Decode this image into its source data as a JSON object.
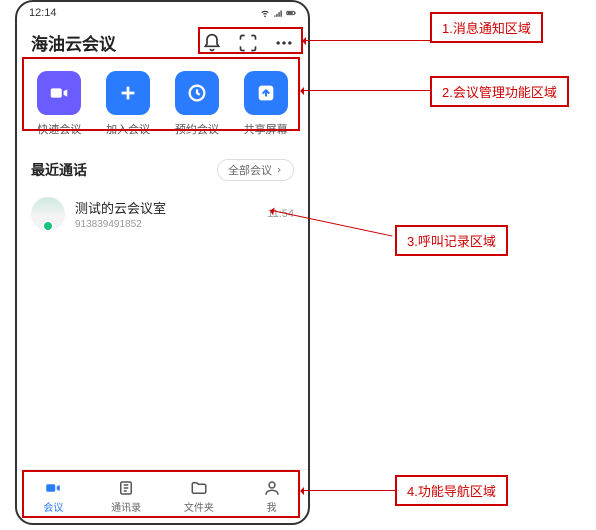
{
  "status": {
    "time": "12:14"
  },
  "header": {
    "title": "海油云会议",
    "icons": {
      "bell": "bell-icon",
      "scan": "scan-icon",
      "more": "more-icon"
    }
  },
  "actions": [
    {
      "label": "快速会议",
      "icon": "video-icon",
      "color": "purple"
    },
    {
      "label": "加入会议",
      "icon": "plus-icon",
      "color": "blue"
    },
    {
      "label": "预约会议",
      "icon": "clock-icon",
      "color": "blue"
    },
    {
      "label": "共享屏幕",
      "icon": "upload-icon",
      "color": "blue"
    }
  ],
  "recent": {
    "title": "最近通话",
    "filter_label": "全部会议",
    "items": [
      {
        "name": "测试的云会议室",
        "sub": "913839491852",
        "time": "11:54"
      }
    ]
  },
  "nav": [
    {
      "label": "会议",
      "icon": "nav-video-icon",
      "active": true
    },
    {
      "label": "通讯录",
      "icon": "nav-contacts-icon",
      "active": false
    },
    {
      "label": "文件夹",
      "icon": "nav-folder-icon",
      "active": false
    },
    {
      "label": "我",
      "icon": "nav-me-icon",
      "active": false
    }
  ],
  "callouts": {
    "c1": "1.消息通知区域",
    "c2": "2.会议管理功能区域",
    "c3": "3.呼叫记录区域",
    "c4": "4.功能导航区域"
  }
}
